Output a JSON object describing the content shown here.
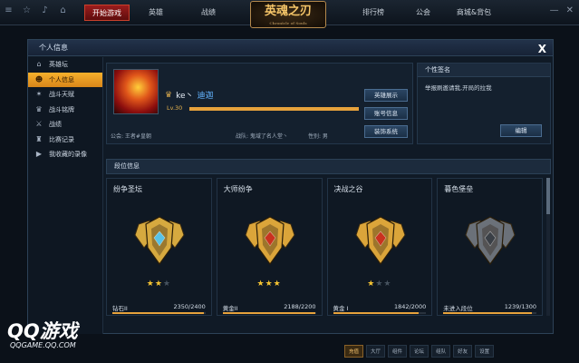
{
  "topbar": {
    "nav": [
      "开始游戏",
      "英雄",
      "战绩",
      "排行榜",
      "公会",
      "商城&背包"
    ],
    "logo": "英魂之刃",
    "logo_sub": "Chronicle of Souls"
  },
  "dialog": {
    "title": "个人信息",
    "close": "X"
  },
  "sidebar": {
    "items": [
      {
        "label": "英雄坛",
        "icon": "temple-icon"
      },
      {
        "label": "个人信息",
        "icon": "person-icon"
      },
      {
        "label": "战斗天赋",
        "icon": "talent-icon"
      },
      {
        "label": "战斗铭牌",
        "icon": "badge-icon"
      },
      {
        "label": "战绩",
        "icon": "sword-icon"
      },
      {
        "label": "比赛记录",
        "icon": "trophy-icon"
      },
      {
        "label": "我收藏的录像",
        "icon": "video-icon"
      }
    ]
  },
  "profile": {
    "name": "ke丶",
    "name_highlight": "迪迦",
    "level": "Lv.30",
    "level_progress": 1.0,
    "guild": "公会: 王者#皇朝",
    "team": "战队: 鬼域了名人堂丶",
    "gender": "性别: 男",
    "buttons": [
      "英雄展示",
      "账号信息",
      "装饰系统"
    ]
  },
  "signature": {
    "title": "个性签名",
    "text": "举报刷邀请我,开局的拉我",
    "edit": "编辑"
  },
  "rank": {
    "title": "段位信息",
    "cards": [
      {
        "mode": "纷争圣坛",
        "tier": "钻石II",
        "stars": 2,
        "max_stars": 3,
        "points": "2350/2400",
        "progress": 0.979,
        "emblem_color": "#d6a93f",
        "gem_color": "#58c2e6"
      },
      {
        "mode": "大师纷争",
        "tier": "黄金II",
        "stars": 3,
        "max_stars": 3,
        "points": "2188/2200",
        "progress": 0.995,
        "emblem_color": "#dba53a",
        "gem_color": "#c9321e"
      },
      {
        "mode": "决战之谷",
        "tier": "黄金 I",
        "stars": 1,
        "max_stars": 3,
        "points": "1842/2000",
        "progress": 0.921,
        "emblem_color": "#dba53a",
        "gem_color": "#c9321e"
      },
      {
        "mode": "暮色堡垒",
        "tier": "未进入段位",
        "stars": 0,
        "max_stars": 0,
        "points": "1239/1300",
        "progress": 0.953,
        "emblem_color": "#6b7179",
        "gem_color": "#3a3f46"
      }
    ]
  },
  "watermark": {
    "brand": "QQ游戏",
    "site": "QQGAME.QQ.COM"
  },
  "bottombar": {
    "items": [
      "充值",
      "大厅",
      "组件",
      "论坛",
      "组队",
      "好友",
      "设置"
    ]
  }
}
